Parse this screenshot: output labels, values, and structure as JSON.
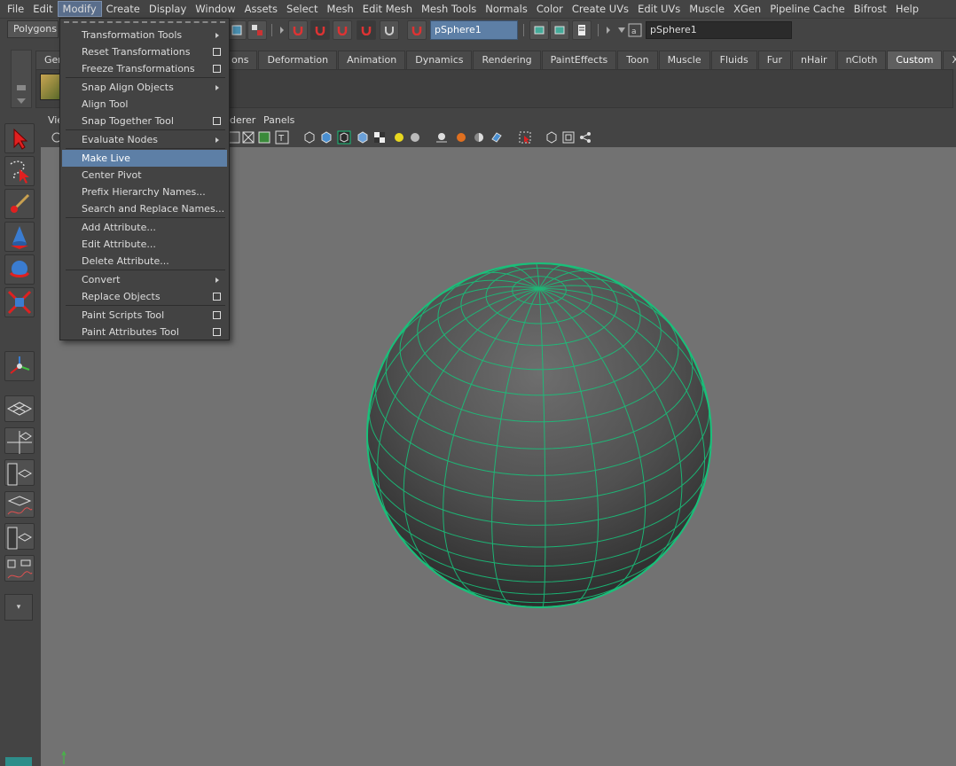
{
  "menubar": {
    "items": [
      "File",
      "Edit",
      "Modify",
      "Create",
      "Display",
      "Window",
      "Assets",
      "Select",
      "Mesh",
      "Edit Mesh",
      "Mesh Tools",
      "Normals",
      "Color",
      "Create UVs",
      "Edit UVs",
      "Muscle",
      "XGen",
      "Pipeline Cache",
      "Bifrost",
      "Help"
    ],
    "active": "Modify"
  },
  "statusline": {
    "mode": "Polygons",
    "object_field": "pSphere1",
    "name_field": "pSphere1"
  },
  "shelf": {
    "tabs": [
      "Gen",
      "ons",
      "Deformation",
      "Animation",
      "Dynamics",
      "Rendering",
      "PaintEffects",
      "Toon",
      "Muscle",
      "Fluids",
      "Fur",
      "nHair",
      "nCloth",
      "Custom",
      "XGen"
    ],
    "active_tab": "Custom"
  },
  "panel": {
    "menus": [
      "Vie",
      "derer",
      "Panels"
    ]
  },
  "dropdown": {
    "items": [
      {
        "label": "Transformation Tools",
        "submenu": true,
        "option": false
      },
      {
        "label": "Reset Transformations",
        "submenu": false,
        "option": true
      },
      {
        "label": "Freeze Transformations",
        "submenu": false,
        "option": true
      },
      {
        "label": "Snap Align Objects",
        "submenu": true,
        "option": false
      },
      {
        "label": "Align Tool",
        "submenu": false,
        "option": false
      },
      {
        "label": "Snap Together Tool",
        "submenu": false,
        "option": true
      },
      {
        "label": "Evaluate Nodes",
        "submenu": true,
        "option": false
      },
      {
        "label": "Make Live",
        "submenu": false,
        "option": false,
        "highlighted": true
      },
      {
        "label": "Center Pivot",
        "submenu": false,
        "option": false
      },
      {
        "label": "Prefix Hierarchy Names...",
        "submenu": false,
        "option": false
      },
      {
        "label": "Search and Replace Names...",
        "submenu": false,
        "option": false
      },
      {
        "label": "Add Attribute...",
        "submenu": false,
        "option": false
      },
      {
        "label": "Edit Attribute...",
        "submenu": false,
        "option": false
      },
      {
        "label": "Delete Attribute...",
        "submenu": false,
        "option": false
      },
      {
        "label": "Convert",
        "submenu": true,
        "option": false
      },
      {
        "label": "Replace Objects",
        "submenu": false,
        "option": true
      },
      {
        "label": "Paint Scripts Tool",
        "submenu": false,
        "option": true
      },
      {
        "label": "Paint Attributes Tool",
        "submenu": false,
        "option": true
      }
    ]
  },
  "colors": {
    "highlight": "#5d7fa6",
    "wireframe": "#19c07a",
    "viewport_bg": "#727272"
  }
}
